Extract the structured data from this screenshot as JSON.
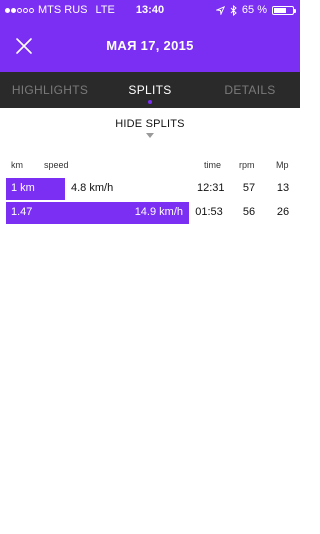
{
  "status": {
    "carrier": "MTS RUS",
    "network": "LTE",
    "time": "13:40",
    "battery": "65 %",
    "battery_level": 0.65
  },
  "header": {
    "title": "МАЯ 17, 2015",
    "accent": "#7b2ff2"
  },
  "tabs": [
    {
      "label": "HIGHLIGHTS",
      "active": false
    },
    {
      "label": "SPLITS",
      "active": true
    },
    {
      "label": "DETAILS",
      "active": false
    }
  ],
  "splits": {
    "toggle_label": "HIDE SPLITS",
    "columns": {
      "km": "km",
      "speed": "speed",
      "time": "time",
      "rpm": "rpm",
      "mp": "Mp"
    },
    "rows": [
      {
        "km": "1 km",
        "speed": "4.8 km/h",
        "time": "12:31",
        "rpm": "57",
        "mp": "13",
        "speed_value": 4.8
      },
      {
        "km": "1.47",
        "speed": "14.9 km/h",
        "time": "01:53",
        "rpm": "56",
        "mp": "26",
        "speed_value": 14.9
      }
    ]
  }
}
